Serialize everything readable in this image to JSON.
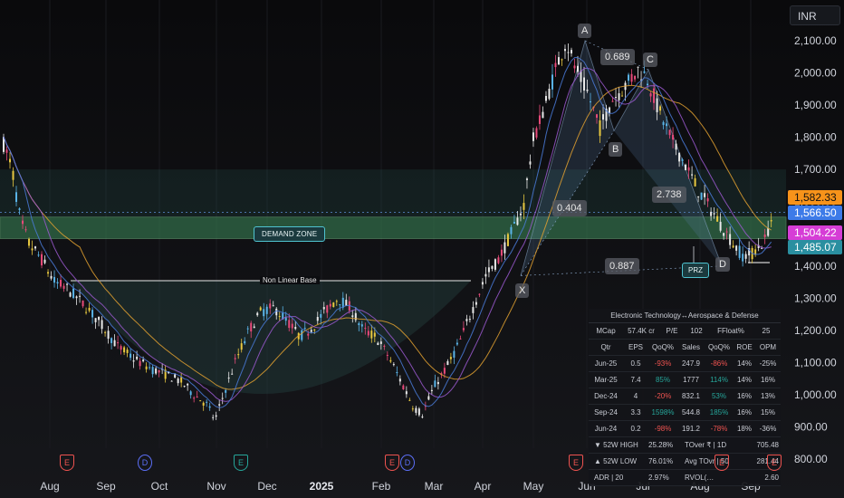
{
  "currency": "INR",
  "price_tags": [
    "1,582.33",
    "1,566.50",
    "1,504.22",
    "1,485.07"
  ],
  "annotations": {
    "points": {
      "A": "A",
      "B": "B",
      "C": "C",
      "D": "D",
      "X": "X"
    },
    "ratios": {
      "ab": "0.689",
      "bc": "2.738",
      "xb": "0.404",
      "xd": "0.887"
    },
    "demand_zone": "DEMAND ZONE",
    "non_linear_base": "Non Linear Base",
    "prz": "PRZ"
  },
  "event_markers": [
    "E",
    "D",
    "E",
    "E",
    "D",
    "E",
    "E",
    "E"
  ],
  "fundamentals": {
    "header": "Electronic Technology↔Aerospace & Defense",
    "summary": [
      "MCap",
      "57.4K cr",
      "P/E",
      "102",
      "FFloat%",
      "25"
    ],
    "columns": [
      "Qtr",
      "EPS",
      "QoQ%",
      "Sales",
      "QoQ%",
      "ROE",
      "OPM"
    ],
    "rows": [
      [
        "Jun-25",
        "0.5",
        "-93%",
        "247.9",
        "-86%",
        "14%",
        "-25%"
      ],
      [
        "Mar-25",
        "7.4",
        "85%",
        "1777",
        "114%",
        "14%",
        "16%"
      ],
      [
        "Dec-24",
        "4",
        "-20%",
        "832.1",
        "53%",
        "16%",
        "13%"
      ],
      [
        "Sep-24",
        "3.3",
        "1598%",
        "544.8",
        "185%",
        "16%",
        "15%"
      ],
      [
        "Jun-24",
        "0.2",
        "-98%",
        "191.2",
        "-78%",
        "18%",
        "-36%"
      ]
    ],
    "stats": [
      [
        "▼ 52W HIGH",
        "25.28%",
        "TOver ₹ | 1D",
        "705.48"
      ],
      [
        "▲ 52W LOW",
        "76.01%",
        "Avg TOvr | 50",
        "281.44"
      ],
      [
        "ADR | 20",
        "2.97%",
        "RVOL(…",
        "2.60"
      ]
    ]
  },
  "chart_data": {
    "type": "candlestick",
    "title": "",
    "x_ticks": [
      "Aug",
      "Sep",
      "Oct",
      "Nov",
      "Dec",
      "2025",
      "Feb",
      "Mar",
      "Apr",
      "May",
      "Jun",
      "Jul",
      "Aug",
      "Sep"
    ],
    "y_ticks": [
      "2,100.00",
      "2,000.00",
      "1,900.00",
      "1,800.00",
      "1,700.00",
      "1,600.00",
      "1,500.00",
      "1,400.00",
      "1,300.00",
      "1,200.00",
      "1,100.00",
      "1,000.00",
      "900.00",
      "800.00"
    ],
    "ylim": [
      760,
      2230
    ],
    "demand_zone": [
      1485.07,
      1552
    ],
    "non_linear_base_level": 1360,
    "marked_prices": [
      1582.33,
      1566.5,
      1504.22,
      1485.07
    ],
    "harmonic_pattern": {
      "X": 1370,
      "A": 2100,
      "B": 1820,
      "C": 2010,
      "D": 1400,
      "ratios": {
        "AB_XA": 0.689,
        "BC_AB": 2.738,
        "XB": 0.404,
        "XD": 0.887
      }
    },
    "price_path": [
      [
        0,
        1780
      ],
      [
        4,
        1700
      ],
      [
        8,
        1540
      ],
      [
        12,
        1470
      ],
      [
        18,
        1420
      ],
      [
        24,
        1350
      ],
      [
        30,
        1330
      ],
      [
        38,
        1280
      ],
      [
        46,
        1220
      ],
      [
        54,
        1150
      ],
      [
        62,
        1110
      ],
      [
        70,
        1080
      ],
      [
        78,
        1060
      ],
      [
        84,
        1040
      ],
      [
        90,
        1000
      ],
      [
        96,
        970
      ],
      [
        100,
        920
      ],
      [
        104,
        1000
      ],
      [
        110,
        1110
      ],
      [
        116,
        1200
      ],
      [
        122,
        1260
      ],
      [
        128,
        1270
      ],
      [
        134,
        1230
      ],
      [
        140,
        1180
      ],
      [
        146,
        1210
      ],
      [
        152,
        1260
      ],
      [
        158,
        1300
      ],
      [
        164,
        1270
      ],
      [
        170,
        1200
      ],
      [
        176,
        1180
      ],
      [
        182,
        1120
      ],
      [
        188,
        1040
      ],
      [
        194,
        960
      ],
      [
        198,
        940
      ],
      [
        204,
        1030
      ],
      [
        210,
        1090
      ],
      [
        216,
        1170
      ],
      [
        222,
        1270
      ],
      [
        228,
        1370
      ],
      [
        234,
        1420
      ],
      [
        240,
        1500
      ],
      [
        246,
        1590
      ],
      [
        250,
        1780
      ],
      [
        256,
        1900
      ],
      [
        262,
        2030
      ],
      [
        266,
        2100
      ],
      [
        270,
        2020
      ],
      [
        276,
        1940
      ],
      [
        282,
        1830
      ],
      [
        288,
        1920
      ],
      [
        294,
        1960
      ],
      [
        300,
        2010
      ],
      [
        304,
        1990
      ],
      [
        310,
        1880
      ],
      [
        316,
        1790
      ],
      [
        322,
        1720
      ],
      [
        328,
        1640
      ],
      [
        334,
        1580
      ],
      [
        340,
        1520
      ],
      [
        346,
        1460
      ],
      [
        350,
        1430
      ],
      [
        354,
        1440
      ],
      [
        360,
        1480
      ],
      [
        364,
        1566.5
      ]
    ],
    "moving_averages": [
      {
        "color": "#e0a030"
      },
      {
        "color": "#9b59d0"
      },
      {
        "color": "#4a7bd9"
      }
    ]
  }
}
